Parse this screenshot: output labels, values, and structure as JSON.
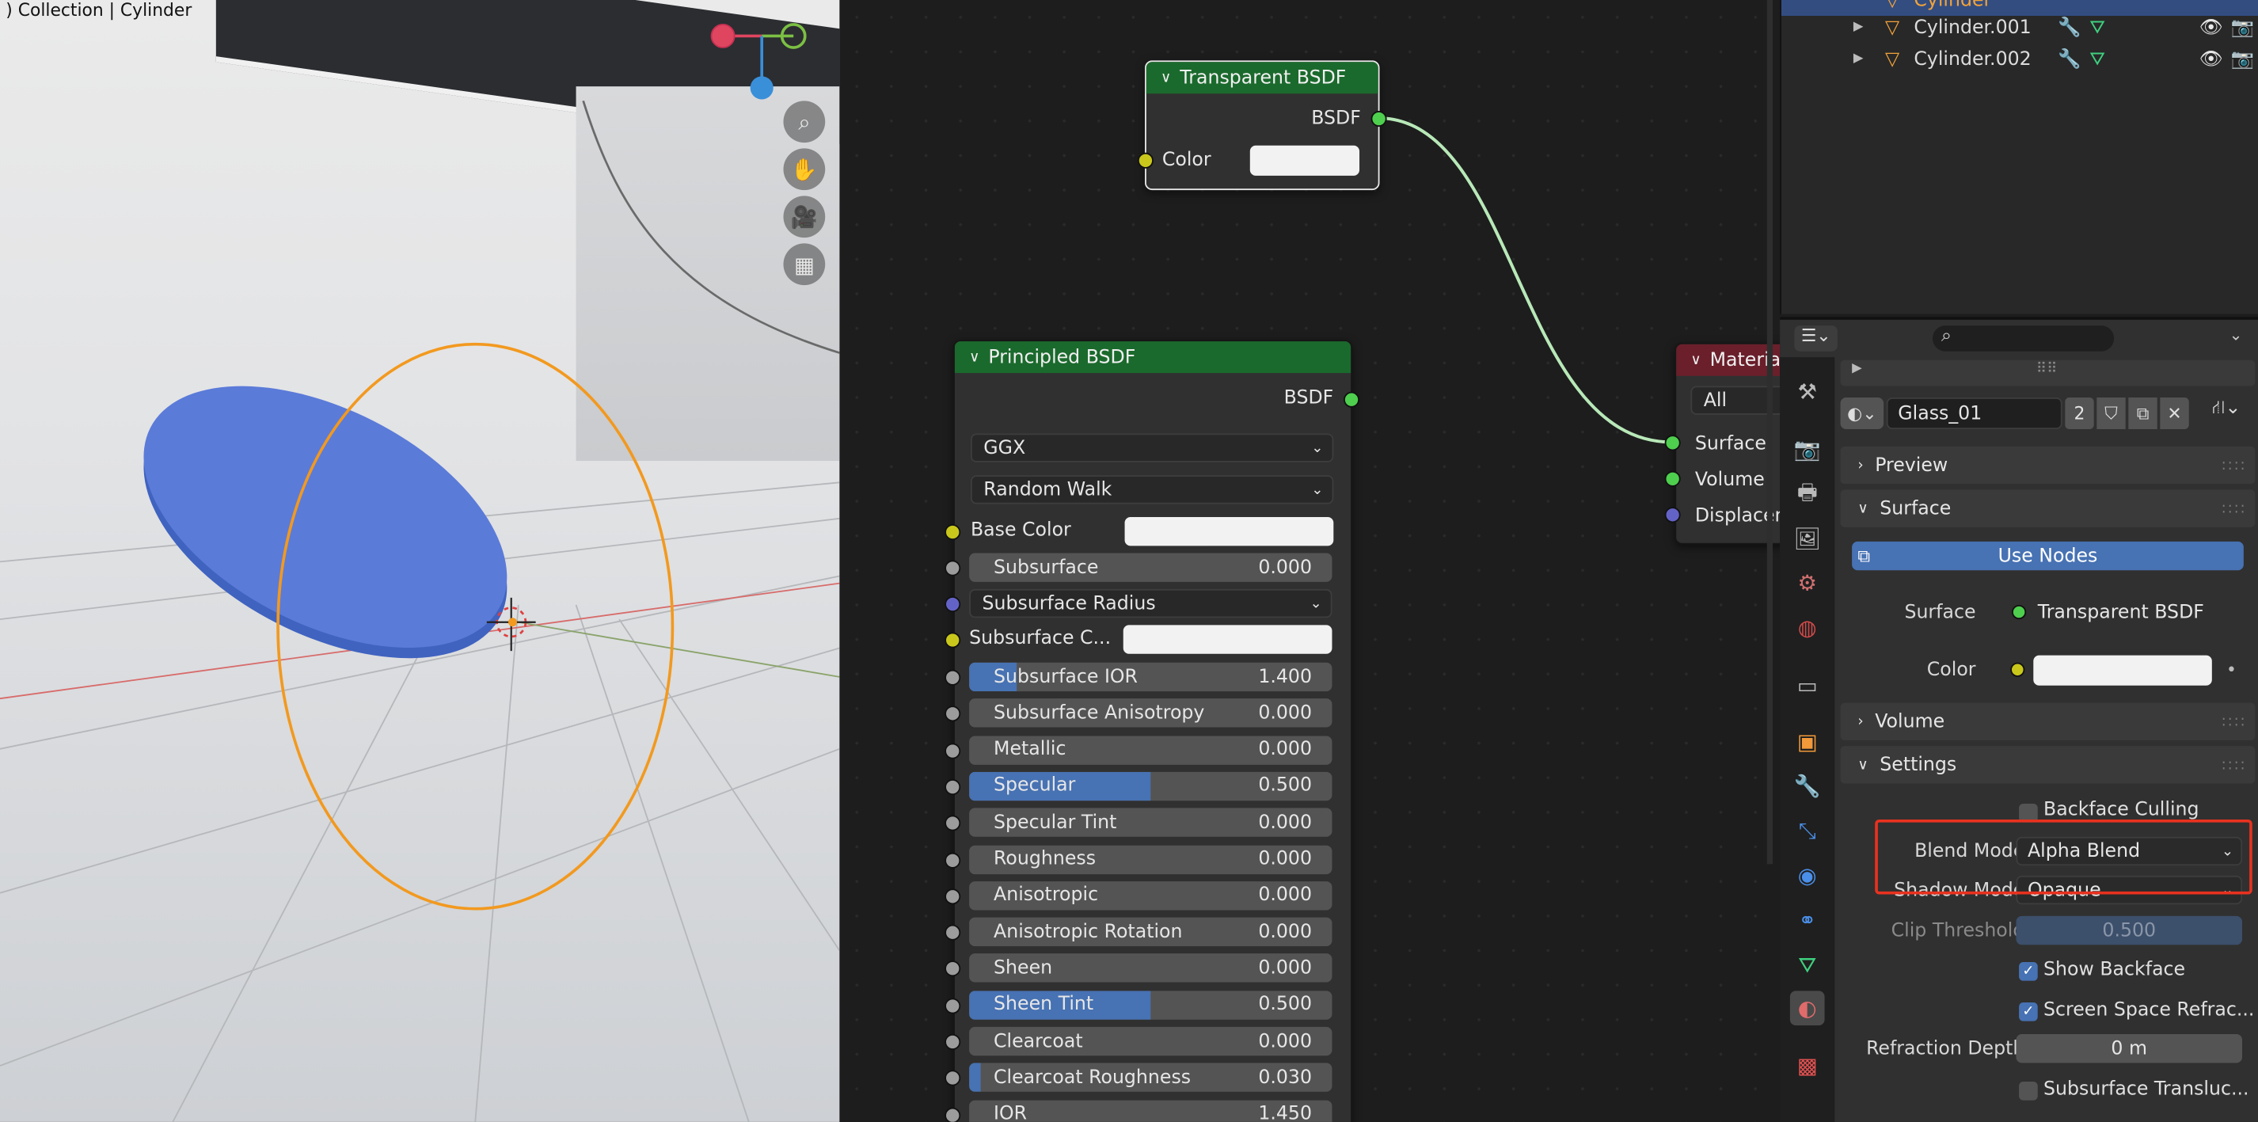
{
  "viewport": {
    "header": ") Collection | Cylinder",
    "nav_icons": [
      "zoom-icon",
      "pan-hand-icon",
      "camera-icon",
      "grid-icon"
    ]
  },
  "node_editor": {
    "transparent_node": {
      "title": "Transparent BSDF",
      "output": "BSDF",
      "color_label": "Color"
    },
    "principled_node": {
      "title": "Principled BSDF",
      "output": "BSDF",
      "distribution": "GGX",
      "subsurface_method": "Random Walk",
      "base_color_label": "Base Color",
      "subsurface_radius_label": "Subsurface Radius",
      "subsurface_color_label": "Subsurface C...",
      "fields": [
        {
          "label": "Subsurface",
          "value": "0.000",
          "fill": 0
        },
        {
          "label": "Subsurface IOR",
          "value": "1.400",
          "fill": 0.13
        },
        {
          "label": "Subsurface Anisotropy",
          "value": "0.000",
          "fill": 0
        },
        {
          "label": "Metallic",
          "value": "0.000",
          "fill": 0
        },
        {
          "label": "Specular",
          "value": "0.500",
          "fill": 0.5
        },
        {
          "label": "Specular Tint",
          "value": "0.000",
          "fill": 0
        },
        {
          "label": "Roughness",
          "value": "0.000",
          "fill": 0
        },
        {
          "label": "Anisotropic",
          "value": "0.000",
          "fill": 0
        },
        {
          "label": "Anisotropic Rotation",
          "value": "0.000",
          "fill": 0
        },
        {
          "label": "Sheen",
          "value": "0.000",
          "fill": 0
        },
        {
          "label": "Sheen Tint",
          "value": "0.500",
          "fill": 0.5
        },
        {
          "label": "Clearcoat",
          "value": "0.000",
          "fill": 0
        },
        {
          "label": "Clearcoat Roughness",
          "value": "0.030",
          "fill": 0.03
        },
        {
          "label": "IOR",
          "value": "1.450",
          "fill": 0
        }
      ]
    },
    "material_output_node": {
      "title": "Materia",
      "target": "All",
      "inputs": [
        "Surface",
        "Volume",
        "Displacem"
      ]
    }
  },
  "outliner": {
    "rows": [
      {
        "name": "Cylinder",
        "selected": true
      },
      {
        "name": "Cylinder.001",
        "selected": false
      },
      {
        "name": "Cylinder.002",
        "selected": false
      }
    ]
  },
  "properties": {
    "material_name": "Glass_01",
    "user_count": "2",
    "panels": {
      "preview": "Preview",
      "surface": "Surface",
      "volume": "Volume",
      "settings": "Settings"
    },
    "use_nodes": "Use Nodes",
    "surface_label": "Surface",
    "surface_value": "Transparent BSDF",
    "color_label": "Color",
    "backface_culling": "Backface Culling",
    "blend_mode_label": "Blend Mode",
    "blend_mode_value": "Alpha Blend",
    "shadow_mode_label": "Shadow Mode",
    "shadow_mode_value": "Opaque",
    "clip_threshold_label": "Clip Threshold",
    "clip_threshold_value": "0.500",
    "show_backface": "Show Backface",
    "screen_space_refraction": "Screen Space Refrac...",
    "refraction_depth_label": "Refraction Depth",
    "refraction_depth_value": "0 m",
    "subsurface_translucency": "Subsurface Transluc...",
    "highlight_color": "#e8321f",
    "accent_color": "#4772b3"
  }
}
